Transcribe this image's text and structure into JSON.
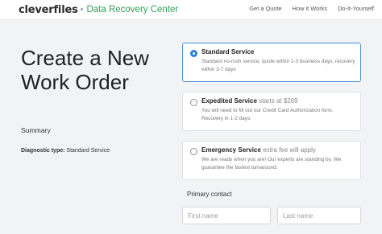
{
  "header": {
    "brand": "cleverfiles",
    "separator": "•",
    "subtitle": "Data Recovery Center",
    "nav": [
      "Get a Quote",
      "How it Works",
      "Do-It-Yourself"
    ]
  },
  "main": {
    "title": "Create a New Work Order",
    "summary_label": "Summary",
    "diagnostic_key": "Diagnostic type:",
    "diagnostic_value": "Standard Service"
  },
  "options": [
    {
      "title": "Standard Service",
      "extra": "",
      "description": "Standard no-rush service, quote within 1-3 business days, recovery within 3-7 days",
      "selected": true
    },
    {
      "title": "Expedited Service",
      "extra": "starts at $269",
      "description": "You will need to fill out our Credit Card Authorization form. Recovery in 1-2 days.",
      "selected": false
    },
    {
      "title": "Emergency Service",
      "extra": "extra fee will apply",
      "description": "We are ready when you are! Our experts are standing by. We guarantee the fastest turnaround.",
      "selected": false
    }
  ],
  "contact": {
    "label": "Primary contact",
    "first_name_placeholder": "First name",
    "last_name_placeholder": "Last name"
  },
  "colors": {
    "accent": "#2b7fd9",
    "brand_green": "#2e9e57",
    "background": "#f2f3f5"
  }
}
